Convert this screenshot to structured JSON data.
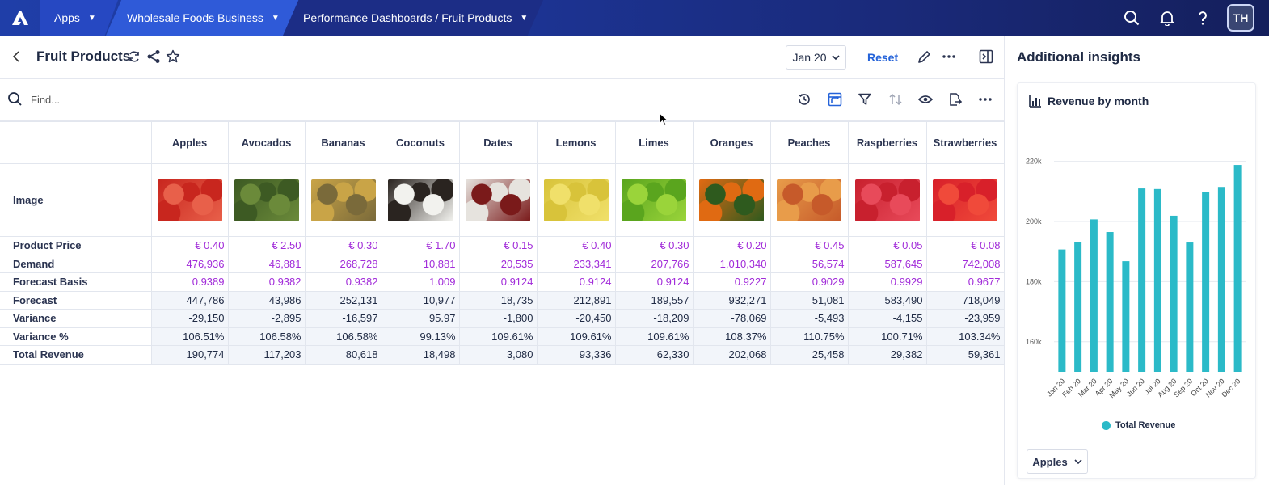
{
  "nav": {
    "apps_label": "Apps",
    "workspace_label": "Wholesale Foods Business",
    "page_path_label": "Performance Dashboards / Fruit Products",
    "avatar_initials": "TH"
  },
  "header": {
    "title": "Fruit Products",
    "date_selector": "Jan 20",
    "reset_label": "Reset"
  },
  "toolbar": {
    "find_placeholder": "Find..."
  },
  "grid": {
    "columns": [
      "Apples",
      "Avocados",
      "Bananas",
      "Coconuts",
      "Dates",
      "Lemons",
      "Limes",
      "Oranges",
      "Peaches",
      "Raspberries",
      "Strawberries"
    ],
    "image_row_label": "Image",
    "rows": [
      {
        "label": "Product Price",
        "style": "purple",
        "values": [
          "€ 0.40",
          "€ 2.50",
          "€ 0.30",
          "€ 1.70",
          "€ 0.15",
          "€ 0.40",
          "€ 0.30",
          "€ 0.20",
          "€ 0.45",
          "€ 0.05",
          "€ 0.08"
        ]
      },
      {
        "label": "Demand",
        "style": "purple",
        "values": [
          "476,936",
          "46,881",
          "268,728",
          "10,881",
          "20,535",
          "233,341",
          "207,766",
          "1,010,340",
          "56,574",
          "587,645",
          "742,008"
        ]
      },
      {
        "label": "Forecast Basis",
        "style": "purple",
        "values": [
          "0.9389",
          "0.9382",
          "0.9382",
          "1.009",
          "0.9124",
          "0.9124",
          "0.9124",
          "0.9227",
          "0.9029",
          "0.9929",
          "0.9677"
        ]
      },
      {
        "label": "Forecast",
        "style": "calc",
        "values": [
          "447,786",
          "43,986",
          "252,131",
          "10,977",
          "18,735",
          "212,891",
          "189,557",
          "932,271",
          "51,081",
          "583,490",
          "718,049"
        ]
      },
      {
        "label": "Variance",
        "style": "calc",
        "values": [
          "-29,150",
          "-2,895",
          "-16,597",
          "95.97",
          "-1,800",
          "-20,450",
          "-18,209",
          "-78,069",
          "-5,493",
          "-4,155",
          "-23,959"
        ]
      },
      {
        "label": "Variance %",
        "style": "calc",
        "values": [
          "106.51%",
          "106.58%",
          "106.58%",
          "99.13%",
          "109.61%",
          "109.61%",
          "109.61%",
          "108.37%",
          "110.75%",
          "100.71%",
          "103.34%"
        ]
      },
      {
        "label": "Total Revenue",
        "style": "calc",
        "values": [
          "190,774",
          "117,203",
          "80,618",
          "18,498",
          "3,080",
          "93,336",
          "62,330",
          "202,068",
          "25,458",
          "29,382",
          "59,361"
        ]
      }
    ],
    "image_colors": [
      [
        "#c8261e",
        "#e8604a"
      ],
      [
        "#3d5a23",
        "#6b8a3a"
      ],
      [
        "#c9a447",
        "#7a6a3a"
      ],
      [
        "#2a2420",
        "#f2f2ee"
      ],
      [
        "#e6e3de",
        "#7a1a1a"
      ],
      [
        "#d8c33a",
        "#f0e06a"
      ],
      [
        "#5aa51e",
        "#9ad43a"
      ],
      [
        "#e06a12",
        "#2e5a1e"
      ],
      [
        "#e89c4a",
        "#c65a2a"
      ],
      [
        "#c8202e",
        "#e84a5a"
      ],
      [
        "#d8202a",
        "#f04a3a"
      ]
    ]
  },
  "panel": {
    "title": "Additional insights",
    "card_title": "Revenue by month",
    "legend_label": "Total Revenue",
    "selector_value": "Apples",
    "bar_color": "#2bbac8"
  },
  "chart_data": {
    "type": "bar",
    "categories": [
      "Jan 20",
      "Feb 20",
      "Mar 20",
      "Apr 20",
      "May 20",
      "Jun 20",
      "Jul 20",
      "Aug 20",
      "Sep 20",
      "Oct 20",
      "Nov 20",
      "Dec 20"
    ],
    "series": [
      {
        "name": "Total Revenue",
        "values": [
          190700,
          193200,
          200700,
          196500,
          186800,
          211000,
          210800,
          201900,
          193000,
          209700,
          211500,
          218800
        ]
      }
    ],
    "ylim": [
      150000,
      225000
    ],
    "yticks": [
      160000,
      180000,
      200000,
      220000
    ],
    "ytick_labels": [
      "160k",
      "180k",
      "200k",
      "220k"
    ],
    "grid": true,
    "legend_position": "bottom"
  }
}
